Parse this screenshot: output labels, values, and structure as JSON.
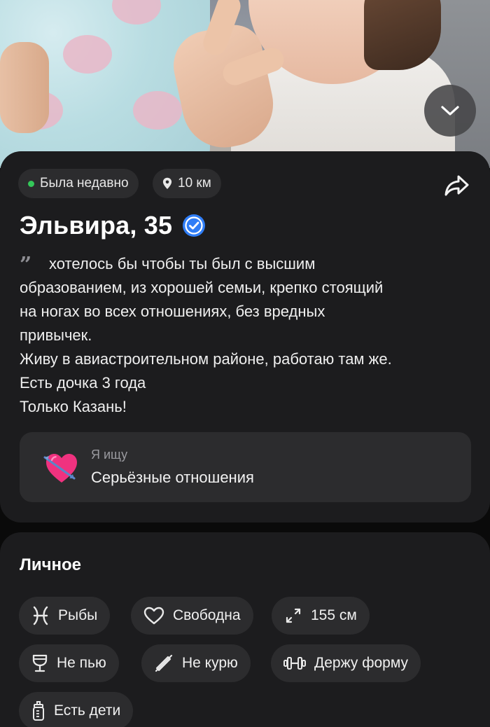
{
  "photo": {
    "expand_icon": "chevron-down-icon"
  },
  "status": {
    "online_label": "Была недавно",
    "distance_label": "10 км",
    "online_color": "#34c759"
  },
  "profile": {
    "name_age": "Эльвира, 35",
    "verified": true,
    "bio_lines": [
      "хотелось бы чтобы ты был с высшим",
      "образованием, из хорошей семьи, крепко стоящий",
      "на ногах во всех отношениях, без вредных",
      "привычек.",
      "Живу в авиастроительном районе, работаю там же.",
      "Есть дочка 3 года",
      "Только Казань!"
    ]
  },
  "looking_for": {
    "label": "Я ищу",
    "value": "Серьёзные отношения",
    "icon": "heart-arrow-icon"
  },
  "personal": {
    "title": "Личное",
    "tags": [
      {
        "label": "Рыбы",
        "icon": "pisces-icon"
      },
      {
        "label": "Свободна",
        "icon": "heart-outline-icon"
      },
      {
        "label": "155 см",
        "icon": "height-icon"
      },
      {
        "label": "Не пью",
        "icon": "glass-icon"
      },
      {
        "label": "Не курю",
        "icon": "no-smoking-icon"
      },
      {
        "label": "Держу форму",
        "icon": "dumbbell-icon"
      },
      {
        "label": "Есть дети",
        "icon": "baby-bottle-icon"
      }
    ]
  },
  "colors": {
    "card_bg": "#1c1c1e",
    "chip_bg": "#2c2c2e",
    "verified_blue": "#2f7df6"
  }
}
